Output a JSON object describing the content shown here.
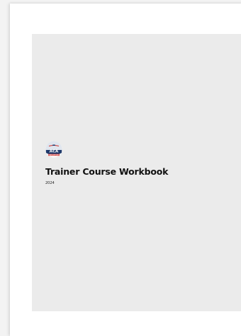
{
  "document": {
    "title": "Trainer Course Workbook",
    "year": "2024",
    "logo": {
      "letters": "ACA",
      "tagline": "PADDLESPORTS",
      "colors": {
        "navy": "#1f3a6b",
        "red": "#d0312d"
      }
    },
    "colors": {
      "page_background": "#f3f3f3",
      "sheet": "#ffffff",
      "cover_panel": "#ebebeb"
    }
  }
}
